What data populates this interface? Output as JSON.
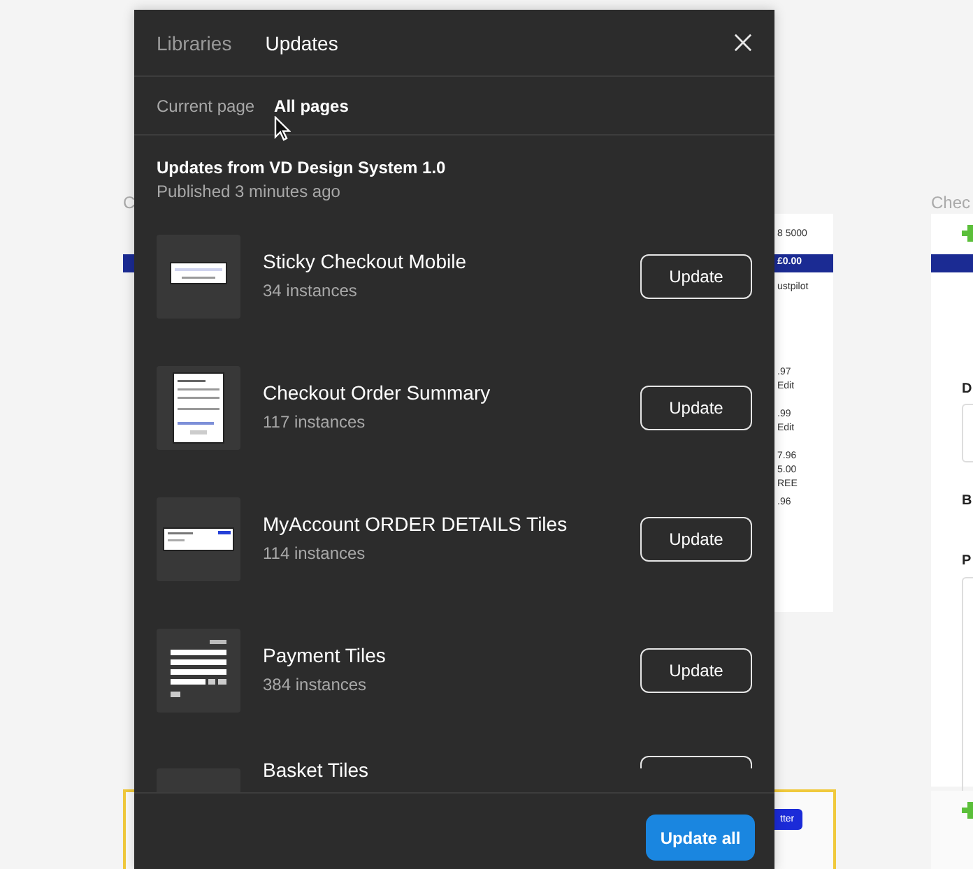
{
  "canvas": {
    "left_frame_title": "C",
    "right_frame_title": "Chec",
    "middle_frame_texts": [
      "8 5000",
      "£0.00",
      "ustpilot",
      ".97",
      "Edit",
      ".99",
      "Edit",
      "7.96",
      "5.00",
      "REE",
      ".96"
    ],
    "middle_frame_button": "tter",
    "right_frame_headings": [
      "D",
      "B",
      "P"
    ]
  },
  "dialog": {
    "tabs": [
      {
        "label": "Libraries",
        "selected": false
      },
      {
        "label": "Updates",
        "selected": true
      }
    ],
    "subtabs": [
      {
        "label": "Current page",
        "selected": false
      },
      {
        "label": "All pages",
        "selected": true
      }
    ],
    "section": {
      "title": "Updates from VD Design System 1.0",
      "subtitle": "Published 3 minutes ago"
    },
    "components": [
      {
        "name": "Sticky Checkout Mobile",
        "instances": "34 instances",
        "button": "Update"
      },
      {
        "name": "Checkout Order Summary",
        "instances": "117 instances",
        "button": "Update"
      },
      {
        "name": "MyAccount ORDER DETAILS Tiles",
        "instances": "114 instances",
        "button": "Update"
      },
      {
        "name": "Payment Tiles",
        "instances": "384 instances",
        "button": "Update"
      },
      {
        "name": "Basket Tiles"
      }
    ],
    "footer_button": "Update all"
  }
}
